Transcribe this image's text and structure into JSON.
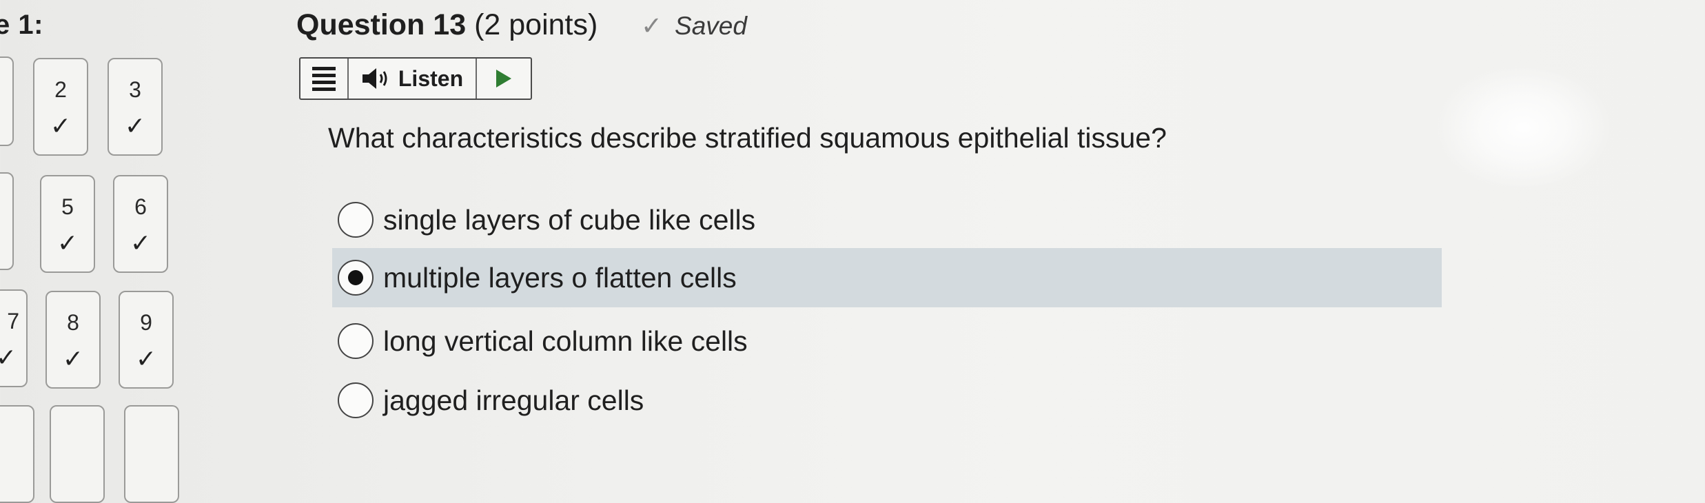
{
  "nav": {
    "title": "e 1:",
    "items": [
      {
        "number": "2",
        "status": "✓"
      },
      {
        "number": "3",
        "status": "✓"
      },
      {
        "number": "5",
        "status": "✓"
      },
      {
        "number": "6",
        "status": "✓"
      },
      {
        "number": "8",
        "status": "✓"
      },
      {
        "number": "9",
        "status": "✓"
      }
    ],
    "partial_left_items": [
      {
        "number": "7",
        "status": "✓"
      }
    ]
  },
  "question": {
    "label": "Question 13",
    "points": "(2 points)",
    "saved_icon": "checkmark-icon",
    "saved_text": "Saved",
    "prompt": "What characteristics describe stratified squamous epithelial tissue?",
    "options": [
      {
        "label": "single layers of cube like cells",
        "selected": false
      },
      {
        "label": "multiple layers o flatten cells",
        "selected": true
      },
      {
        "label": "long vertical column like cells",
        "selected": false
      },
      {
        "label": "jagged irregular cells",
        "selected": false
      }
    ]
  },
  "toolbar": {
    "menu_icon": "menu-icon",
    "speaker_icon": "speaker-icon",
    "listen_label": "Listen",
    "play_icon": "play-icon"
  },
  "colors": {
    "selected_option_bg": "#d3dade",
    "play_green": "#2f7d32"
  }
}
